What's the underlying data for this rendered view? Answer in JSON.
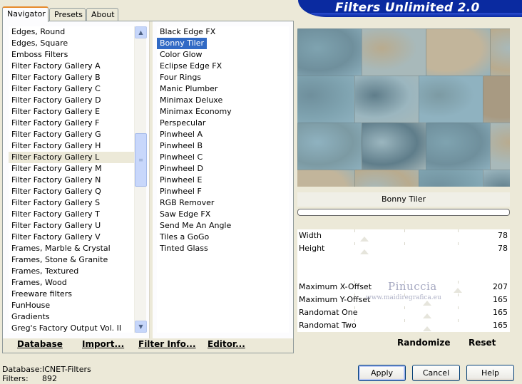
{
  "window": {
    "title": "Filters Unlimited 2.0"
  },
  "tabs": [
    {
      "label": "Navigator",
      "active": true
    },
    {
      "label": "Presets",
      "active": false
    },
    {
      "label": "About",
      "active": false
    }
  ],
  "categories": {
    "items": [
      "Edges, Round",
      "Edges, Square",
      "Emboss Filters",
      "Filter Factory Gallery A",
      "Filter Factory Gallery B",
      "Filter Factory Gallery C",
      "Filter Factory Gallery D",
      "Filter Factory Gallery E",
      "Filter Factory Gallery F",
      "Filter Factory Gallery G",
      "Filter Factory Gallery H",
      "Filter Factory Gallery L",
      "Filter Factory Gallery M",
      "Filter Factory Gallery N",
      "Filter Factory Gallery Q",
      "Filter Factory Gallery S",
      "Filter Factory Gallery T",
      "Filter Factory Gallery U",
      "Filter Factory Gallery V",
      "Frames, Marble & Crystal",
      "Frames, Stone & Granite",
      "Frames, Textured",
      "Frames, Wood",
      "Freeware filters",
      "FunHouse",
      "Gradients",
      "Greg's Factory Output Vol. II"
    ],
    "selected": "Filter Factory Gallery L"
  },
  "filters": {
    "items": [
      "Black Edge FX",
      "Bonny Tiler",
      "Color Glow",
      "Eclipse Edge FX",
      "Four Rings",
      "Manic Plumber",
      "Minimax Deluxe",
      "Minimax Economy",
      "Perspecular",
      "Pinwheel A",
      "Pinwheel B",
      "Pinwheel C",
      "Pinwheel D",
      "Pinwheel E",
      "Pinwheel F",
      "RGB Remover",
      "Saw Edge FX",
      "Send Me An Angle",
      "Tiles a GoGo",
      "Tinted Glass"
    ],
    "selected": "Bonny Tiler"
  },
  "bottom_buttons": {
    "database": "Database",
    "import": "Import...",
    "filter_info": "Filter Info...",
    "editor": "Editor..."
  },
  "filter_name": "Bonny Tiler",
  "sliders": [
    {
      "label": "Width",
      "value": "78"
    },
    {
      "label": "Height",
      "value": "78"
    },
    {
      "label": "Maximum X-Offset",
      "value": "207"
    },
    {
      "label": "Maximum Y-Offset",
      "value": "165"
    },
    {
      "label": "Randomat One",
      "value": "165"
    },
    {
      "label": "Randomat Two",
      "value": "165"
    }
  ],
  "slider_levels": [
    78,
    78,
    207,
    165,
    165,
    165
  ],
  "right_buttons": {
    "randomize": "Randomize",
    "reset": "Reset"
  },
  "watermark": {
    "name": "Pinuccia",
    "url": "www.maidiregrafica.eu"
  },
  "status": {
    "database_label": "Database:",
    "database_value": "ICNET-Filters",
    "filters_label": "Filters:",
    "filters_value": "892"
  },
  "dialog_buttons": {
    "apply": "Apply",
    "cancel": "Cancel",
    "help": "Help"
  },
  "colors": {
    "banner": "#0a2aa0",
    "selection": "#316ac5",
    "tab_highlight": "#e68b2c"
  }
}
